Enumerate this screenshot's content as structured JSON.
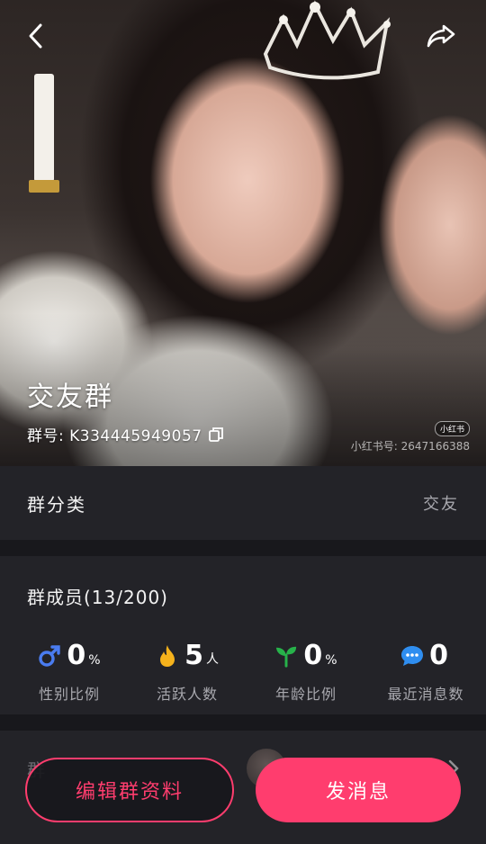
{
  "header": {
    "back_icon": "chevron-left-icon",
    "share_icon": "share-arrow-icon"
  },
  "hero": {
    "group_name": "交友群",
    "group_id": "群号: K334445949057",
    "copy_icon": "copy-icon",
    "watermark_badge": "小红书",
    "watermark_text": "小红书号: 2647166388"
  },
  "category": {
    "label": "群分类",
    "value": "交友"
  },
  "members": {
    "title": "群成员(13/200)",
    "stats": [
      {
        "icon": "gender-icon",
        "value": "0",
        "unit": "%",
        "label": "性别比例",
        "color": "#4a7cf0"
      },
      {
        "icon": "flame-icon",
        "value": "5",
        "unit": "人",
        "label": "活跃人数",
        "color": "#f5b21c"
      },
      {
        "icon": "sprout-icon",
        "value": "0",
        "unit": "%",
        "label": "年龄比例",
        "color": "#27b24a"
      },
      {
        "icon": "chat-bubble-icon",
        "value": "0",
        "unit": "",
        "label": "最近消息数",
        "color": "#2f8ef0"
      }
    ]
  },
  "bottom": {
    "ghost_label": "群"
  },
  "actions": {
    "edit_label": "编辑群资料",
    "send_label": "发消息"
  },
  "colors": {
    "accent": "#ff3d6e",
    "card_bg": "#232328",
    "page_bg": "#18181c"
  }
}
